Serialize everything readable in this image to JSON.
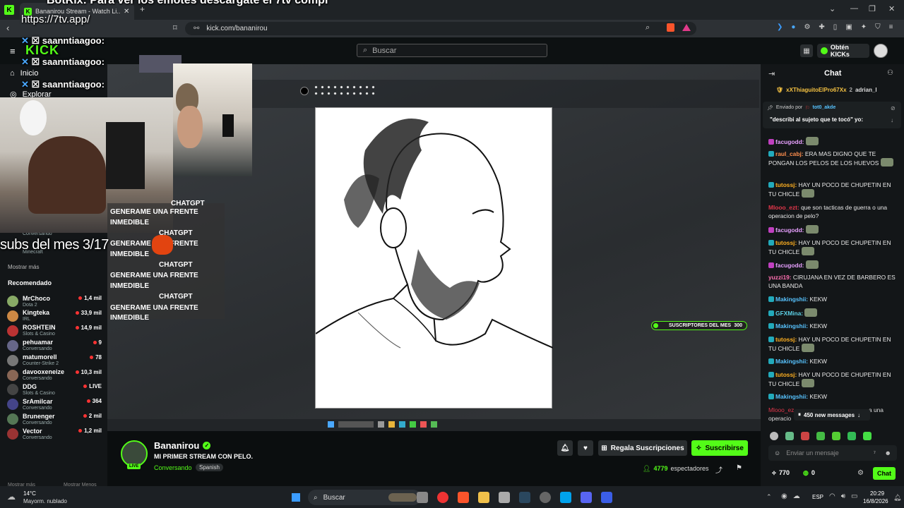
{
  "browser": {
    "tab_title": "Bananirou Stream - Watch Li...",
    "new_tab": "+",
    "url": "kick.com/bananirou"
  },
  "overlay": {
    "ticker": "BotRix: Para ver los emotes descargate el 7tv compl",
    "url_line": "https://7tv.app/",
    "chat_lines": [
      {
        "user": "saanntiaagoo:"
      },
      {
        "user": "saanntiaagoo:"
      },
      {
        "user": "saanntiaagoo:"
      }
    ],
    "subs_month": "subs del mes 3/17",
    "gpt_lines": [
      "CHATGPT",
      "GENERAME UNA FRENTE",
      "INMEDIBLE",
      "CHATGPT",
      "GENERAME UNA FRENTE",
      "INMEDIBLE",
      "CHATGPT",
      "GENERAME UNA FRENTE",
      "INMEDIBLE",
      "CHATGPT",
      "GENERAME UNA FRENTE",
      "INMEDIBLE"
    ]
  },
  "header": {
    "logo": "KICK",
    "search_placeholder": "Buscar",
    "obten": "Obtén KICKs"
  },
  "sidebar": {
    "nav": [
      {
        "label": "Inicio",
        "icon": "home-icon"
      },
      {
        "label": "Explorar",
        "icon": "compass-icon"
      }
    ],
    "followed_partial": [
      {
        "category": "Conversando"
      },
      {
        "category": "Minecraft"
      }
    ],
    "show_more": "Mostrar más",
    "recommended_title": "Recomendado",
    "recommended": [
      {
        "name": "MrChoco",
        "category": "Dota 2",
        "viewers": "1,4 mil"
      },
      {
        "name": "Kingteka",
        "category": "IRL",
        "viewers": "33,9 mil"
      },
      {
        "name": "ROSHTEIN",
        "category": "Slots & Casino",
        "viewers": "14,9 mil"
      },
      {
        "name": "pehuamar",
        "category": "Conversando",
        "viewers": "9"
      },
      {
        "name": "matumorell",
        "category": "Counter-Strike 2",
        "viewers": "78"
      },
      {
        "name": "davooxeneize",
        "category": "Conversando",
        "viewers": "10,3 mil"
      },
      {
        "name": "DDG",
        "category": "Slots & Casino",
        "viewers": "LIVE"
      },
      {
        "name": "SrAmilcar",
        "category": "Conversando",
        "viewers": "364"
      },
      {
        "name": "Brunenger",
        "category": "Conversando",
        "viewers": "2 mil"
      },
      {
        "name": "Vector",
        "category": "Conversando",
        "viewers": "1,2 mil"
      }
    ],
    "footer_left": "Mostrar más",
    "footer_right": "Mostrar Menos"
  },
  "video": {
    "subs_label": "SUSCRIPTORES DEL MES",
    "subs_value": "300"
  },
  "stream": {
    "streamer": "Bananirou",
    "title": "MI PRIMER STREAM CON PELO.",
    "category": "Conversando",
    "language": "Spanish",
    "live": "LIVE",
    "gift_label": "Regala Suscripciones",
    "subscribe_label": "Suscribirse",
    "viewers": "4779",
    "viewers_label": "espectadores"
  },
  "chat": {
    "title": "Chat",
    "top_gifters": [
      {
        "name": "xXThiaguitoElPro67Xx",
        "count": "2"
      },
      {
        "name": "adrian_l"
      }
    ],
    "pinned_by_label": "Enviado por",
    "pinned_user": "tot0_akde",
    "pinned_text": "\"describi al sujeto que te tocó\" yo:",
    "messages": [
      {
        "user": "facugodd:",
        "text": "",
        "color": "#e7a0ff",
        "emote": true
      },
      {
        "user": "raul_cabj:",
        "text": "ERA MAS DIGNO QUE TE PONGAN LOS PELOS DE LOS HUEVOS",
        "color": "#ff8e4d",
        "emote": true
      },
      {
        "user": "tutossj:",
        "text": "HAY UN POCO DE CHUPETIN EN TU CHICLE",
        "color": "#ffb020",
        "emote": true
      },
      {
        "user": "Mlooo_ezt:",
        "text": "que son tacticas de guerra o una operacion de pelo?",
        "color": "#e0364a",
        "emote": false
      },
      {
        "user": "facugodd:",
        "text": "",
        "color": "#e7a0ff",
        "emote": true
      },
      {
        "user": "tutossj:",
        "text": "HAY UN POCO DE CHUPETIN EN TU CHICLE",
        "color": "#ffb020",
        "emote": true
      },
      {
        "user": "facugodd:",
        "text": "",
        "color": "#e7a0ff",
        "emote": true
      },
      {
        "user": "yuzzi19:",
        "text": "CIRUJANA EN VEZ DE BARBERO ES UNA BANDA",
        "color": "#ff6fb0",
        "emote": false
      },
      {
        "user": "Makingshii:",
        "text": "KEKW",
        "color": "#57c3ff",
        "emote": false
      },
      {
        "user": "GFXMina:",
        "text": "",
        "color": "#5cd1e6",
        "emote": true
      },
      {
        "user": "Makingshii:",
        "text": "KEKW",
        "color": "#57c3ff",
        "emote": false
      },
      {
        "user": "tutossj:",
        "text": "HAY UN POCO DE CHUPETIN EN TU CHICLE",
        "color": "#ffb020",
        "emote": true
      },
      {
        "user": "Makingshii:",
        "text": "KEKW",
        "color": "#57c3ff",
        "emote": false
      },
      {
        "user": "tutossj:",
        "text": "HAY UN POCO DE CHUPETIN EN TU CHICLE",
        "color": "#ffb020",
        "emote": true
      },
      {
        "user": "Makingshii:",
        "text": "KEKW",
        "color": "#57c3ff",
        "emote": false
      }
    ],
    "partial_user": "Mlooo_ez",
    "partial_tail": "a una",
    "partial_line2": "operacio",
    "new_messages": "450 new messages",
    "input_placeholder": "Enviar un mensaje",
    "kicks": "770",
    "points": "0",
    "chat_button": "Chat"
  },
  "taskbar": {
    "weather_temp": "14°C",
    "weather_desc": "Mayorm. nublado",
    "search": "Buscar",
    "lang": "ESP",
    "time": "20:29",
    "date": "16/8/2026"
  }
}
